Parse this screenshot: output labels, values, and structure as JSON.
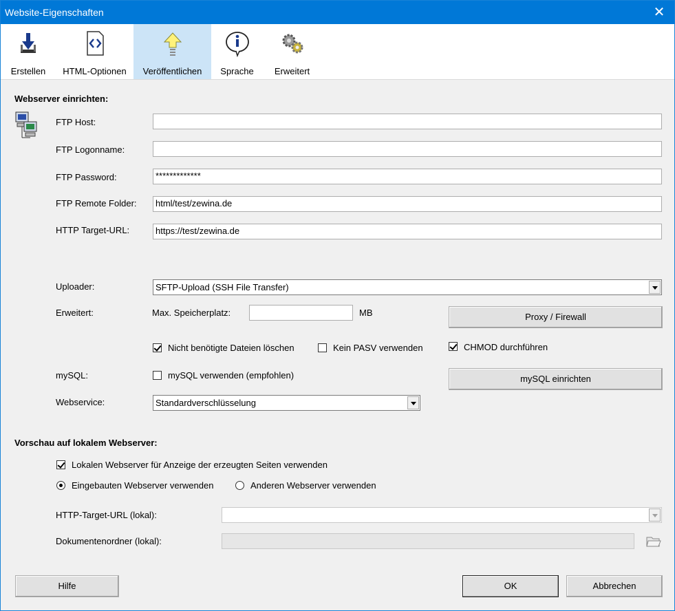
{
  "window": {
    "title": "Website-Eigenschaften",
    "close_label": "✕"
  },
  "tabs": [
    {
      "label": "Erstellen",
      "icon": "download-icon"
    },
    {
      "label": "HTML-Optionen",
      "icon": "html-icon"
    },
    {
      "label": "Veröffentlichen",
      "icon": "upload-icon",
      "selected": true
    },
    {
      "label": "Sprache",
      "icon": "info-icon"
    },
    {
      "label": "Erweitert",
      "icon": "gears-icon"
    }
  ],
  "webserver": {
    "heading": "Webserver einrichten:",
    "ftp_host_label": "FTP Host:",
    "ftp_host_value": "",
    "ftp_logon_label": "FTP Logonname:",
    "ftp_logon_value": "",
    "ftp_password_label": "FTP Password:",
    "ftp_password_value": "*************",
    "ftp_remote_label": "FTP Remote Folder:",
    "ftp_remote_value": "html/test/zewina.de",
    "http_target_label": "HTTP Target-URL:",
    "http_target_value": "https://test/zewina.de",
    "uploader_label": "Uploader:",
    "uploader_value": "SFTP-Upload (SSH File Transfer)",
    "erweitert_label": "Erweitert:",
    "max_speicher_label": "Max. Speicherplatz:",
    "max_speicher_value": "",
    "mb_label": "MB",
    "proxy_button": "Proxy / Firewall",
    "nicht_benoetigte_label": "Nicht benötigte Dateien löschen",
    "nicht_benoetigte_checked": true,
    "kein_pasv_label": "Kein PASV verwenden",
    "kein_pasv_checked": false,
    "chmod_label": "CHMOD durchführen",
    "chmod_checked": true,
    "mysql_label": "mySQL:",
    "mysql_verwenden_label": "mySQL verwenden (empfohlen)",
    "mysql_verwenden_checked": false,
    "mysql_button": "mySQL einrichten",
    "webservice_label": "Webservice:",
    "webservice_value": "Standardverschlüsselung"
  },
  "preview": {
    "heading": "Vorschau auf lokalem Webserver:",
    "lokal_label": "Lokalen Webserver für Anzeige der erzeugten Seiten verwenden",
    "lokal_checked": true,
    "eingebaut_label": "Eingebauten Webserver verwenden",
    "andere_label": "Anderen Webserver verwenden",
    "selected_radio": "eingebaut",
    "http_lokal_label": "HTTP-Target-URL (lokal):",
    "http_lokal_value": "",
    "dokument_label": "Dokumentenordner (lokal):",
    "dokument_value": ""
  },
  "footer": {
    "hilfe": "Hilfe",
    "ok": "OK",
    "abbrechen": "Abbrechen"
  }
}
